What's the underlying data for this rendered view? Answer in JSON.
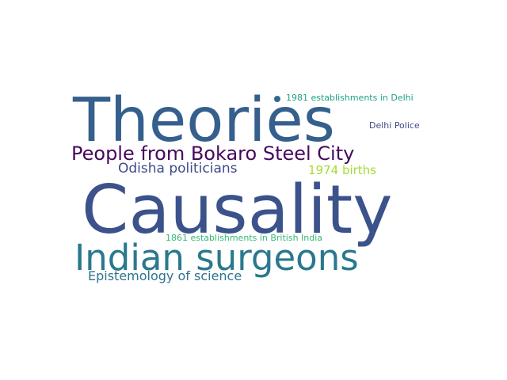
{
  "words": {
    "theories": {
      "text": "Theories",
      "color": "#355f8d"
    },
    "causality": {
      "text": "Causality",
      "color": "#3b528b"
    },
    "surgeons": {
      "text": "Indian surgeons",
      "color": "#2a788e"
    },
    "bokaro": {
      "text": "People from Bokaro Steel City",
      "color": "#46085c"
    },
    "odisha": {
      "text": "Odisha politicians",
      "color": "#3e4a89"
    },
    "births1974": {
      "text": "1974 births",
      "color": "#a8db34"
    },
    "episte": {
      "text": "Epistemology of science",
      "color": "#2c728e"
    },
    "est1861": {
      "text": "1861 establishments in British India",
      "color": "#35b779"
    },
    "est1981": {
      "text": "1981 establishments in Delhi",
      "color": "#1fa187"
    },
    "delhi": {
      "text": "Delhi Police",
      "color": "#3e4a89"
    }
  },
  "dot_color": "#31688e"
}
